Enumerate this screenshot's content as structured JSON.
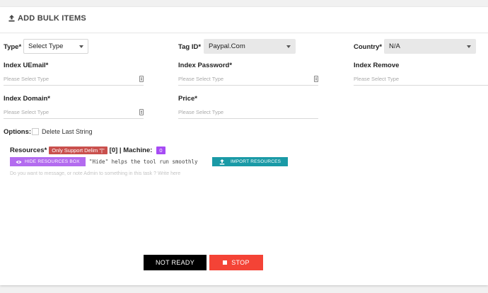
{
  "header": {
    "title": "ADD BULK ITEMS",
    "icon": "upload-icon"
  },
  "fields": {
    "type": {
      "label": "Type*",
      "value": "Select Type"
    },
    "tag_id": {
      "label": "Tag ID*",
      "value": "Paypal.Com"
    },
    "country": {
      "label": "Country*",
      "value": "N/A"
    },
    "index_uemail": {
      "label": "Index UEmail*",
      "placeholder": "Please Select Type"
    },
    "index_password": {
      "label": "Index Password*",
      "placeholder": "Please Select Type"
    },
    "index_remove": {
      "label": "Index Remove",
      "placeholder": "Please Select Type"
    },
    "index_domain": {
      "label": "Index Domain*",
      "placeholder": "Please Select Type"
    },
    "price": {
      "label": "Price*",
      "placeholder": "Please Select Type"
    }
  },
  "options": {
    "label": "Options:",
    "delete_last_string": "Delete Last String"
  },
  "resources": {
    "label": "Resources*",
    "delim_badge": "Only Support Delim \"|\"",
    "count_text": "[0] | Machine:",
    "machine_badge": "0",
    "hide_button": "HIDE RESOURCES BOX",
    "hint": "\"Hide\" helps the tool run smoothly",
    "import_button": "IMPORT RESOURCES",
    "message_placeholder": "Do you want to message, or note Admin to something in this task ? Write here"
  },
  "actions": {
    "not_ready": "NOT READY",
    "stop": "STOP"
  },
  "colors": {
    "delim_badge": "#c9504d",
    "machine_badge": "#a64bf4",
    "hide_button": "#b36bef",
    "import_button": "#1a9aa6",
    "not_ready": "#000000",
    "stop": "#f44336"
  }
}
